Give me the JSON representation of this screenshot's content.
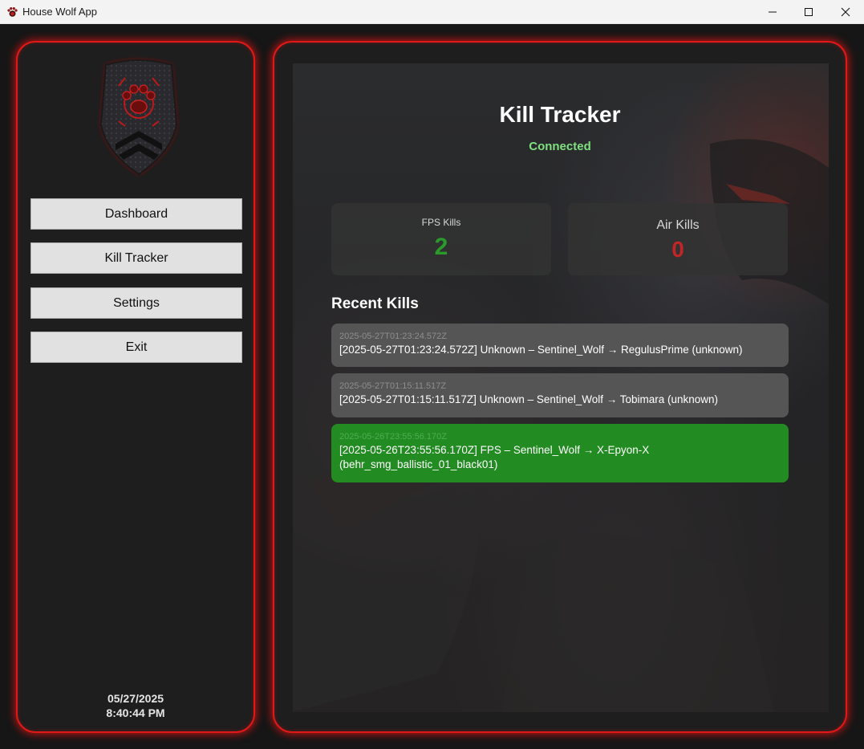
{
  "window": {
    "title": "House Wolf App"
  },
  "sidebar": {
    "logo_icon": "house-wolf-shield-logo",
    "nav": [
      {
        "label": "Dashboard"
      },
      {
        "label": "Kill Tracker"
      },
      {
        "label": "Settings"
      },
      {
        "label": "Exit"
      }
    ],
    "date": "05/27/2025",
    "time": "8:40:44 PM"
  },
  "main": {
    "title": "Kill Tracker",
    "status": "Connected",
    "status_color": "#7fe07f",
    "stats": {
      "fps_label": "FPS Kills",
      "fps_value": "2",
      "air_label": "Air Kills",
      "air_value": "0"
    },
    "recent_title": "Recent Kills",
    "kills": [
      {
        "timestamp": "2025-05-27T01:23:24.572Z",
        "text": "[2025-05-27T01:23:24.572Z] Unknown – Sentinel_Wolf → RegulusPrime (unknown)",
        "kind": "unknown"
      },
      {
        "timestamp": "2025-05-27T01:15:11.517Z",
        "text": "[2025-05-27T01:15:11.517Z] Unknown – Sentinel_Wolf → Tobimara (unknown)",
        "kind": "unknown"
      },
      {
        "timestamp": "2025-05-26T23:55:56.170Z",
        "text": "[2025-05-26T23:55:56.170Z] FPS – Sentinel_Wolf → X-Epyon-X (behr_smg_ballistic_01_black01)",
        "kind": "fps"
      }
    ]
  },
  "colors": {
    "accent_red": "#e01818",
    "fps_green": "#228b22",
    "air_red": "#c02626"
  }
}
